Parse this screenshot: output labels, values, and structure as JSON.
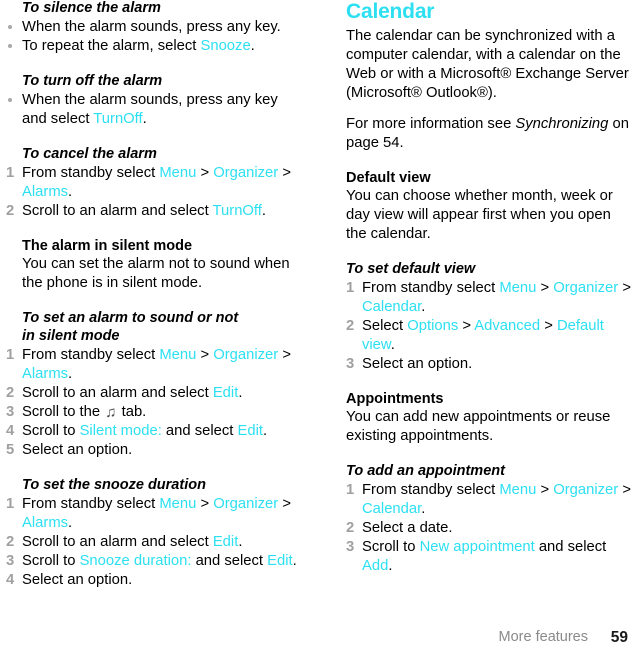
{
  "footer": {
    "section_label": "More features",
    "page_number": "59"
  },
  "colors": {
    "ui_term": "#2ce0f2",
    "heading_accent": "#2ce0f2",
    "list_marker": "#a0a0a0",
    "bullet": "#a9a9a9",
    "body_text": "#000000",
    "footer_label": "#8a8a8a"
  },
  "left_column": {
    "block1": {
      "heading": "To silence the alarm",
      "bullets": [
        {
          "pre": "When the alarm sounds, press any key."
        },
        {
          "pre": "To repeat the alarm, select ",
          "ui": "Snooze",
          "post": "."
        }
      ]
    },
    "block2": {
      "heading": "To turn off the alarm",
      "bullets": [
        {
          "pre": "When the alarm sounds, press any key and select ",
          "ui": "TurnOff",
          "post": "."
        }
      ]
    },
    "block3": {
      "heading": "To cancel the alarm",
      "steps": [
        {
          "num": "1",
          "p1": "From standby select ",
          "ui1": "Menu",
          "p2": " > ",
          "ui2": "Organizer",
          "p3": " > ",
          "ui3": "Alarms",
          "p4": "."
        },
        {
          "num": "2",
          "p1": "Scroll to an alarm and select ",
          "ui1": "TurnOff",
          "p2": "."
        }
      ]
    },
    "block4": {
      "heading": "The alarm in silent mode",
      "body": "You can set the alarm not to sound when the phone is in silent mode."
    },
    "block5": {
      "heading_line1": "To set an alarm to sound or not",
      "heading_line2": "in silent mode",
      "steps": [
        {
          "num": "1",
          "p1": "From standby select ",
          "ui1": "Menu",
          "p2": " > ",
          "ui2": "Organizer",
          "p3": " > ",
          "ui3": "Alarms",
          "p4": "."
        },
        {
          "num": "2",
          "p1": "Scroll to an alarm and select ",
          "ui1": "Edit",
          "p2": "."
        },
        {
          "num": "3",
          "p1": "Scroll to the ",
          "icon": "♫",
          "icon_name": "music-note-tab-icon",
          "p2": " tab."
        },
        {
          "num": "4",
          "p1": "Scroll to ",
          "ui1": "Silent mode:",
          "p2": " and select ",
          "ui2": "Edit",
          "p3": "."
        },
        {
          "num": "5",
          "p1": "Select an option."
        }
      ]
    },
    "block6": {
      "heading": "To set the snooze duration",
      "steps": [
        {
          "num": "1",
          "p1": "From standby select ",
          "ui1": "Menu",
          "p2": " > ",
          "ui2": "Organizer",
          "p3": " > ",
          "ui3": "Alarms",
          "p4": "."
        },
        {
          "num": "2",
          "p1": "Scroll to an alarm and select ",
          "ui1": "Edit",
          "p2": "."
        },
        {
          "num": "3",
          "p1": "Scroll to ",
          "ui1": "Snooze duration:",
          "p2": " and select ",
          "ui2": "Edit",
          "p3": "."
        },
        {
          "num": "4",
          "p1": "Select an option."
        }
      ]
    }
  },
  "right_column": {
    "section_title": "Calendar",
    "intro": "The calendar can be synchronized with a computer calendar, with a calendar on the Web or with a Microsoft® Exchange Server (Microsoft® Outlook®).",
    "xref": {
      "pre": "For more information see ",
      "italic": "Synchronizing",
      "post": " on page 54."
    },
    "block1": {
      "heading": "Default view",
      "body": "You can choose whether month, week or day view will appear first when you open the calendar."
    },
    "block2": {
      "heading": "To set default view",
      "steps": [
        {
          "num": "1",
          "p1": "From standby select ",
          "ui1": "Menu",
          "p2": " > ",
          "ui2": "Organizer",
          "p3": " > ",
          "ui3": "Calendar",
          "p4": "."
        },
        {
          "num": "2",
          "p1": "Select ",
          "ui1": "Options",
          "p2": " > ",
          "ui2": "Advanced",
          "p3": " > ",
          "ui3": "Default view",
          "p4": "."
        },
        {
          "num": "3",
          "p1": "Select an option."
        }
      ]
    },
    "block3": {
      "heading": "Appointments",
      "body": "You can add new appointments or reuse existing appointments."
    },
    "block4": {
      "heading": "To add an appointment",
      "steps": [
        {
          "num": "1",
          "p1": "From standby select ",
          "ui1": "Menu",
          "p2": " > ",
          "ui2": "Organizer",
          "p3": " > ",
          "ui3": "Calendar",
          "p4": "."
        },
        {
          "num": "2",
          "p1": "Select a date."
        },
        {
          "num": "3",
          "p1": "Scroll to ",
          "ui1": "New appointment",
          "p2": " and select ",
          "ui2": "Add",
          "p3": "."
        }
      ]
    }
  }
}
